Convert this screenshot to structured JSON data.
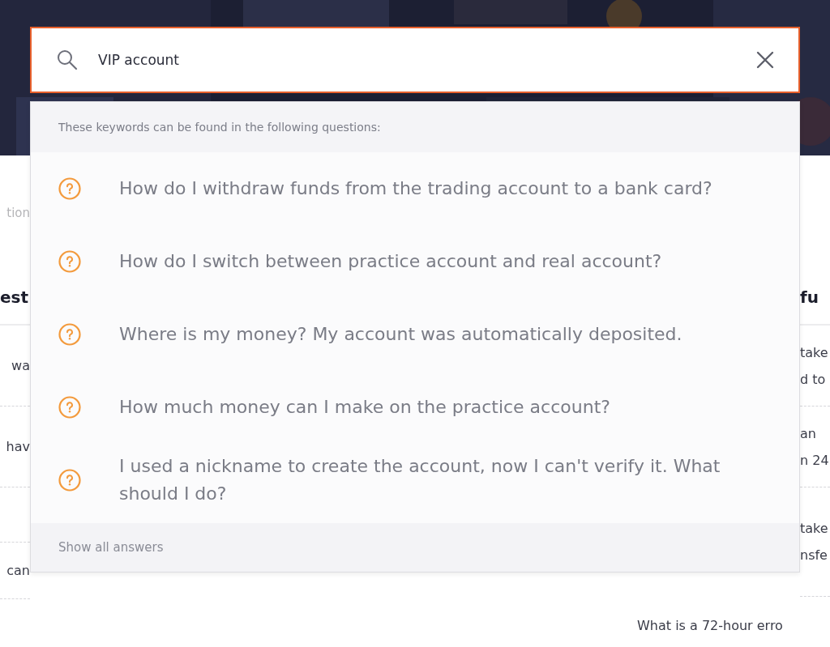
{
  "search": {
    "value": "VIP account"
  },
  "dropdown": {
    "hint": "These keywords can be found in the following questions:",
    "results": [
      {
        "text": "How do I withdraw funds from the trading account to a bank card?"
      },
      {
        "text": "How do I switch between practice account and real account?"
      },
      {
        "text": "Where is my money? My account was automatically deposited."
      },
      {
        "text": "How much money can I make on the practice account?"
      },
      {
        "text": "I used a nickname to create the account, now I can't verify it. What should I do?"
      }
    ],
    "show_all": "Show all answers"
  },
  "left_column": {
    "caption": "tion",
    "heading": "est",
    "rows": [
      "wa",
      "hav",
      "can"
    ]
  },
  "right_column": {
    "heading": "fu",
    "rows": [
      [
        "take",
        "d to"
      ],
      [
        "an",
        "n 24"
      ],
      [
        "take",
        "nsfe"
      ]
    ],
    "last_row": "What is a 72-hour erro"
  }
}
